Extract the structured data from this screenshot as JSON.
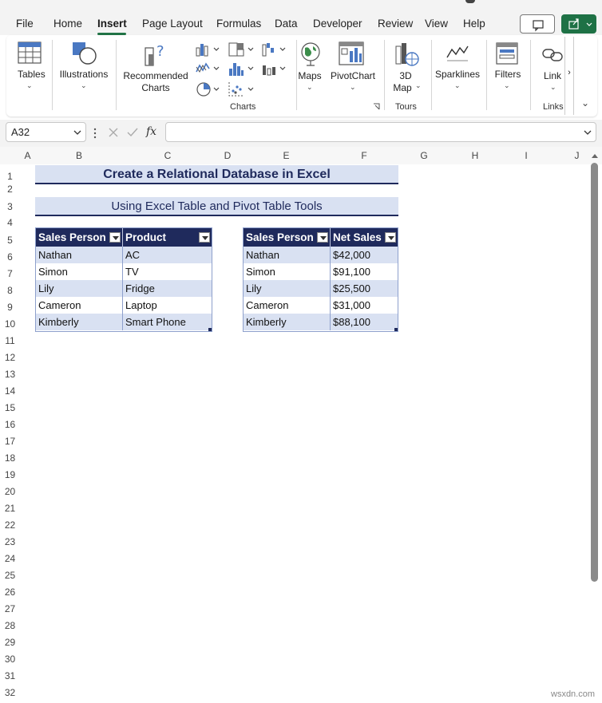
{
  "menu": {
    "tabs": [
      "File",
      "Home",
      "Insert",
      "Page Layout",
      "Formulas",
      "Data",
      "Developer",
      "Review",
      "View",
      "Help"
    ],
    "active": "Insert"
  },
  "ribbon": {
    "tables": "Tables",
    "illustrations": "Illustrations",
    "recommended_charts": [
      "Recommended",
      "Charts"
    ],
    "maps": "Maps",
    "pivotchart": "PivotChart",
    "map3d": [
      "3D",
      "Map"
    ],
    "sparklines": "Sparklines",
    "filters": "Filters",
    "link": "Link",
    "group_charts": "Charts",
    "group_tours": "Tours",
    "group_links": "Links"
  },
  "formula_bar": {
    "name_box": "A32",
    "fx": "fx",
    "value": ""
  },
  "columns": [
    "A",
    "B",
    "C",
    "D",
    "E",
    "F",
    "G",
    "H",
    "I",
    "J"
  ],
  "rows": [
    "1",
    "2",
    "3",
    "4",
    "5",
    "6",
    "7",
    "8",
    "9",
    "10",
    "11",
    "12",
    "13",
    "14",
    "15",
    "16",
    "17",
    "18",
    "19",
    "20",
    "21",
    "22",
    "23",
    "24",
    "25",
    "26",
    "27",
    "28",
    "29",
    "30",
    "31",
    "32"
  ],
  "sheet": {
    "title": "Create a Relational Database in Excel",
    "subtitle": "Using Excel Table and Pivot Table Tools",
    "table1": {
      "headers": [
        "Sales Person",
        "Product"
      ],
      "rows": [
        [
          "Nathan",
          "AC"
        ],
        [
          "Simon",
          "TV"
        ],
        [
          "Lily",
          "Fridge"
        ],
        [
          "Cameron",
          "Laptop"
        ],
        [
          "Kimberly",
          "Smart Phone"
        ]
      ]
    },
    "table2": {
      "headers": [
        "Sales Person",
        "Net Sales"
      ],
      "rows": [
        [
          "Nathan",
          "$42,000"
        ],
        [
          "Simon",
          "$91,100"
        ],
        [
          "Lily",
          "$25,500"
        ],
        [
          "Cameron",
          "$31,000"
        ],
        [
          "Kimberly",
          "$88,100"
        ]
      ]
    }
  },
  "watermark": "wsxdn.com"
}
